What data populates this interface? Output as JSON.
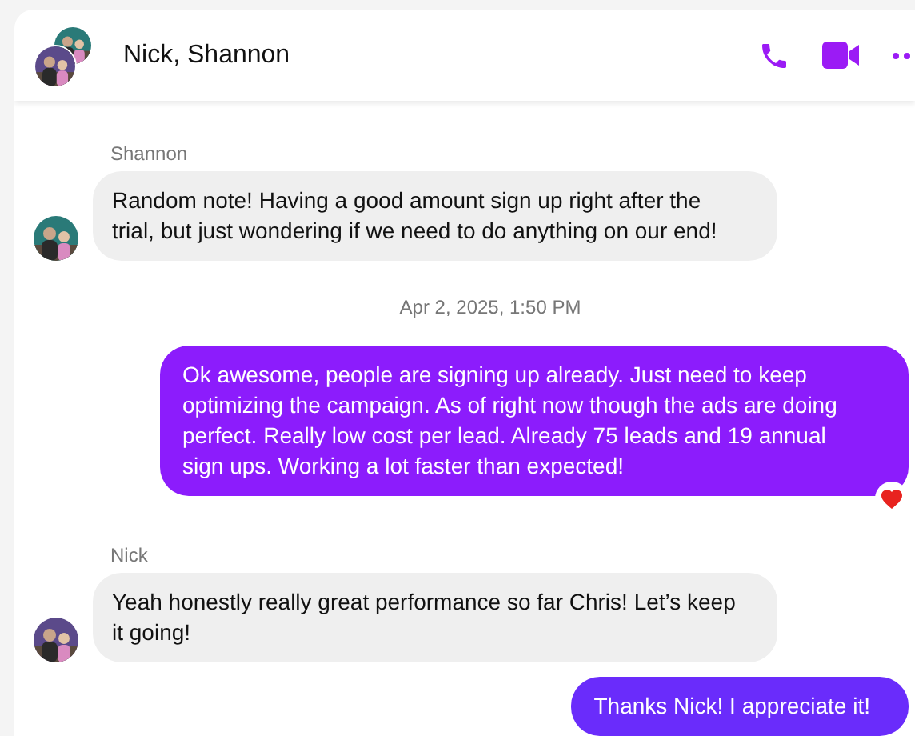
{
  "header": {
    "title": "Nick, Shannon"
  },
  "messages": [
    {
      "kind": "sender",
      "text": "Shannon"
    },
    {
      "kind": "incoming",
      "text": "Random note! Having a good amount sign up right after the trial, but just wondering if we need to do anything on our end!"
    },
    {
      "kind": "timestamp",
      "text": "Apr 2, 2025, 1:50 PM"
    },
    {
      "kind": "outgoing",
      "text": "Ok awesome, people are signing up already. Just need to keep optimizing the campaign. As of right now though the ads are doing perfect. Really low cost per lead. Already 75 leads and 19 annual sign ups. Working a lot faster than expected!",
      "hearted": true,
      "color": "#8c1cfc"
    },
    {
      "kind": "sender",
      "text": "Nick"
    },
    {
      "kind": "incoming",
      "text": "Yeah honestly really great performance so far Chris! Let’s keep it going!"
    },
    {
      "kind": "outgoing",
      "text": "Thanks Nick! I appreciate it!",
      "color": "#6a2cfb"
    }
  ]
}
